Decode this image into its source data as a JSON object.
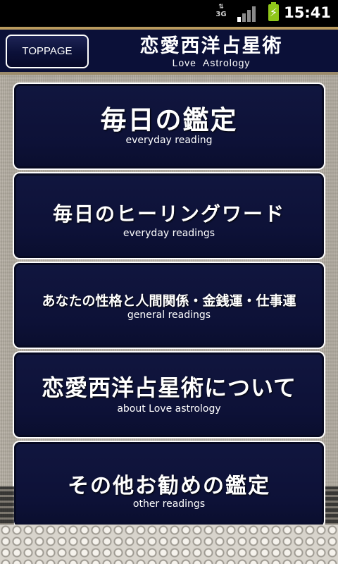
{
  "status_bar": {
    "network": "3G",
    "time": "15:41"
  },
  "header": {
    "toppage_label": "TOPPAGE",
    "title": "恋愛西洋占星術",
    "subtitle": "Love  Astrology"
  },
  "menu": [
    {
      "title": "毎日の鑑定",
      "subtitle": "everyday reading"
    },
    {
      "title": "毎日のヒーリングワード",
      "subtitle": "everyday readings"
    },
    {
      "title": "あなたの性格と人間関係・金銭運・仕事運",
      "subtitle": "general readings"
    },
    {
      "title": "恋愛西洋占星術について",
      "subtitle": "about Love astrology"
    },
    {
      "title": "その他お勧めの鑑定",
      "subtitle": "other readings"
    }
  ],
  "colors": {
    "header_bg": "#0b1038",
    "button_bg": "#0d1137",
    "battery": "#8fc61a"
  }
}
